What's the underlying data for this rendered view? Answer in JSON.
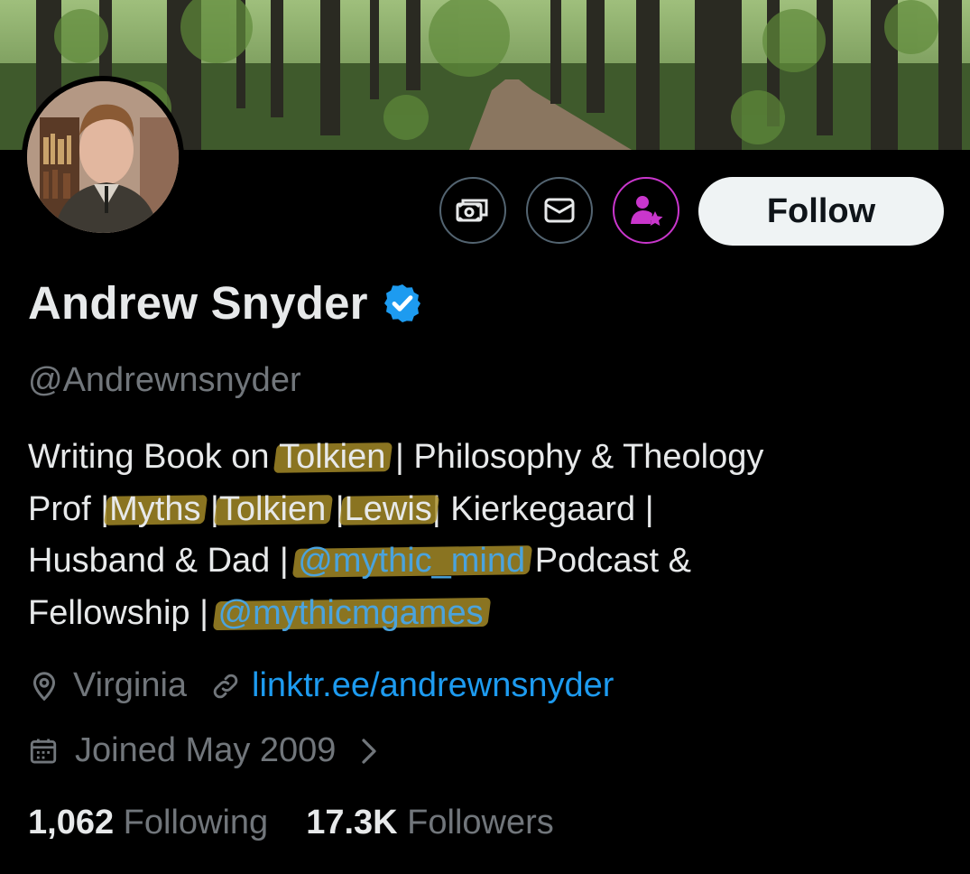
{
  "profile": {
    "name": "Andrew Snyder",
    "handle": "@Andrewnsnyder",
    "verified": true,
    "bio": {
      "l1a": "Writing Book on ",
      "l1_hl": "Tolkien",
      "l1b": " | Philosophy & Theology",
      "l2a": "Prof |",
      "l2_hl1": "Myths",
      "l2_sep1": " |",
      "l2_hl2": "Tolkien",
      "l2_sep2": " |",
      "l2_hl3": "Lewis",
      "l2b": "| Kierkegaard |",
      "l3a": "Husband & Dad | ",
      "l3_mention": "@mythic_mind",
      "l3b": " Podcast &",
      "l4a": "Fellowship | ",
      "l4_mention": "@mythicmgames"
    },
    "location": "Virginia",
    "website": "linktr.ee/andrewnsnyder",
    "joined": "Joined May 2009",
    "following_count": "1,062",
    "following_label": "Following",
    "followers_count": "17.3K",
    "followers_label": "Followers"
  },
  "actions": {
    "follow_label": "Follow",
    "icons": [
      "tip-icon",
      "message-icon",
      "subscribe-icon"
    ]
  },
  "colors": {
    "background": "#000000",
    "text": "#e7e9ea",
    "muted": "#71767b",
    "accent": "#1d9bf0",
    "subscribe": "#c936cc",
    "highlight": "#a88e28"
  }
}
